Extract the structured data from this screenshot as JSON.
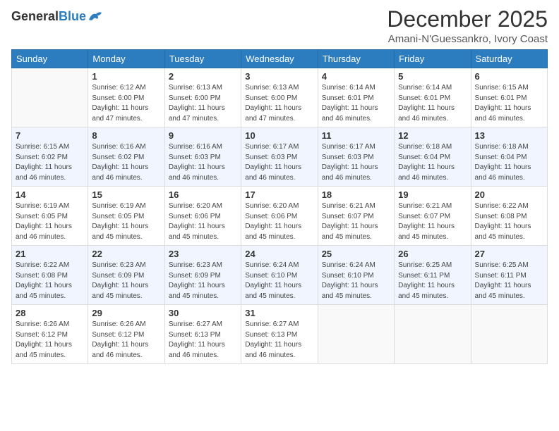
{
  "header": {
    "logo_general": "General",
    "logo_blue": "Blue",
    "month_title": "December 2025",
    "location": "Amani-N'Guessankro, Ivory Coast"
  },
  "days_of_week": [
    "Sunday",
    "Monday",
    "Tuesday",
    "Wednesday",
    "Thursday",
    "Friday",
    "Saturday"
  ],
  "weeks": [
    [
      {
        "day": "",
        "sunrise": "",
        "sunset": "",
        "daylight": ""
      },
      {
        "day": "1",
        "sunrise": "Sunrise: 6:12 AM",
        "sunset": "Sunset: 6:00 PM",
        "daylight": "Daylight: 11 hours and 47 minutes."
      },
      {
        "day": "2",
        "sunrise": "Sunrise: 6:13 AM",
        "sunset": "Sunset: 6:00 PM",
        "daylight": "Daylight: 11 hours and 47 minutes."
      },
      {
        "day": "3",
        "sunrise": "Sunrise: 6:13 AM",
        "sunset": "Sunset: 6:00 PM",
        "daylight": "Daylight: 11 hours and 47 minutes."
      },
      {
        "day": "4",
        "sunrise": "Sunrise: 6:14 AM",
        "sunset": "Sunset: 6:01 PM",
        "daylight": "Daylight: 11 hours and 46 minutes."
      },
      {
        "day": "5",
        "sunrise": "Sunrise: 6:14 AM",
        "sunset": "Sunset: 6:01 PM",
        "daylight": "Daylight: 11 hours and 46 minutes."
      },
      {
        "day": "6",
        "sunrise": "Sunrise: 6:15 AM",
        "sunset": "Sunset: 6:01 PM",
        "daylight": "Daylight: 11 hours and 46 minutes."
      }
    ],
    [
      {
        "day": "7",
        "sunrise": "Sunrise: 6:15 AM",
        "sunset": "Sunset: 6:02 PM",
        "daylight": "Daylight: 11 hours and 46 minutes."
      },
      {
        "day": "8",
        "sunrise": "Sunrise: 6:16 AM",
        "sunset": "Sunset: 6:02 PM",
        "daylight": "Daylight: 11 hours and 46 minutes."
      },
      {
        "day": "9",
        "sunrise": "Sunrise: 6:16 AM",
        "sunset": "Sunset: 6:03 PM",
        "daylight": "Daylight: 11 hours and 46 minutes."
      },
      {
        "day": "10",
        "sunrise": "Sunrise: 6:17 AM",
        "sunset": "Sunset: 6:03 PM",
        "daylight": "Daylight: 11 hours and 46 minutes."
      },
      {
        "day": "11",
        "sunrise": "Sunrise: 6:17 AM",
        "sunset": "Sunset: 6:03 PM",
        "daylight": "Daylight: 11 hours and 46 minutes."
      },
      {
        "day": "12",
        "sunrise": "Sunrise: 6:18 AM",
        "sunset": "Sunset: 6:04 PM",
        "daylight": "Daylight: 11 hours and 46 minutes."
      },
      {
        "day": "13",
        "sunrise": "Sunrise: 6:18 AM",
        "sunset": "Sunset: 6:04 PM",
        "daylight": "Daylight: 11 hours and 46 minutes."
      }
    ],
    [
      {
        "day": "14",
        "sunrise": "Sunrise: 6:19 AM",
        "sunset": "Sunset: 6:05 PM",
        "daylight": "Daylight: 11 hours and 46 minutes."
      },
      {
        "day": "15",
        "sunrise": "Sunrise: 6:19 AM",
        "sunset": "Sunset: 6:05 PM",
        "daylight": "Daylight: 11 hours and 45 minutes."
      },
      {
        "day": "16",
        "sunrise": "Sunrise: 6:20 AM",
        "sunset": "Sunset: 6:06 PM",
        "daylight": "Daylight: 11 hours and 45 minutes."
      },
      {
        "day": "17",
        "sunrise": "Sunrise: 6:20 AM",
        "sunset": "Sunset: 6:06 PM",
        "daylight": "Daylight: 11 hours and 45 minutes."
      },
      {
        "day": "18",
        "sunrise": "Sunrise: 6:21 AM",
        "sunset": "Sunset: 6:07 PM",
        "daylight": "Daylight: 11 hours and 45 minutes."
      },
      {
        "day": "19",
        "sunrise": "Sunrise: 6:21 AM",
        "sunset": "Sunset: 6:07 PM",
        "daylight": "Daylight: 11 hours and 45 minutes."
      },
      {
        "day": "20",
        "sunrise": "Sunrise: 6:22 AM",
        "sunset": "Sunset: 6:08 PM",
        "daylight": "Daylight: 11 hours and 45 minutes."
      }
    ],
    [
      {
        "day": "21",
        "sunrise": "Sunrise: 6:22 AM",
        "sunset": "Sunset: 6:08 PM",
        "daylight": "Daylight: 11 hours and 45 minutes."
      },
      {
        "day": "22",
        "sunrise": "Sunrise: 6:23 AM",
        "sunset": "Sunset: 6:09 PM",
        "daylight": "Daylight: 11 hours and 45 minutes."
      },
      {
        "day": "23",
        "sunrise": "Sunrise: 6:23 AM",
        "sunset": "Sunset: 6:09 PM",
        "daylight": "Daylight: 11 hours and 45 minutes."
      },
      {
        "day": "24",
        "sunrise": "Sunrise: 6:24 AM",
        "sunset": "Sunset: 6:10 PM",
        "daylight": "Daylight: 11 hours and 45 minutes."
      },
      {
        "day": "25",
        "sunrise": "Sunrise: 6:24 AM",
        "sunset": "Sunset: 6:10 PM",
        "daylight": "Daylight: 11 hours and 45 minutes."
      },
      {
        "day": "26",
        "sunrise": "Sunrise: 6:25 AM",
        "sunset": "Sunset: 6:11 PM",
        "daylight": "Daylight: 11 hours and 45 minutes."
      },
      {
        "day": "27",
        "sunrise": "Sunrise: 6:25 AM",
        "sunset": "Sunset: 6:11 PM",
        "daylight": "Daylight: 11 hours and 45 minutes."
      }
    ],
    [
      {
        "day": "28",
        "sunrise": "Sunrise: 6:26 AM",
        "sunset": "Sunset: 6:12 PM",
        "daylight": "Daylight: 11 hours and 45 minutes."
      },
      {
        "day": "29",
        "sunrise": "Sunrise: 6:26 AM",
        "sunset": "Sunset: 6:12 PM",
        "daylight": "Daylight: 11 hours and 46 minutes."
      },
      {
        "day": "30",
        "sunrise": "Sunrise: 6:27 AM",
        "sunset": "Sunset: 6:13 PM",
        "daylight": "Daylight: 11 hours and 46 minutes."
      },
      {
        "day": "31",
        "sunrise": "Sunrise: 6:27 AM",
        "sunset": "Sunset: 6:13 PM",
        "daylight": "Daylight: 11 hours and 46 minutes."
      },
      {
        "day": "",
        "sunrise": "",
        "sunset": "",
        "daylight": ""
      },
      {
        "day": "",
        "sunrise": "",
        "sunset": "",
        "daylight": ""
      },
      {
        "day": "",
        "sunrise": "",
        "sunset": "",
        "daylight": ""
      }
    ]
  ]
}
